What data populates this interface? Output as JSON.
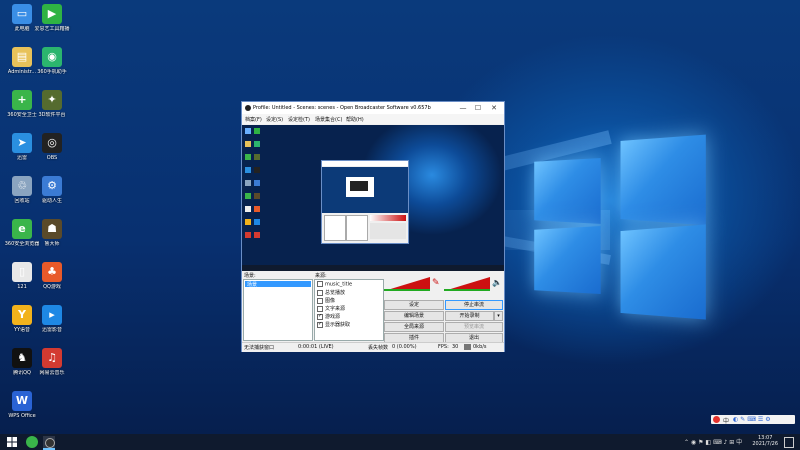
{
  "desktop": {
    "icons": [
      {
        "label": "此电脑",
        "icon": "computer-icon",
        "color": "#3a8ee6",
        "glyph": "▭"
      },
      {
        "label": "爱思艺工具箱播",
        "icon": "media-app-icon",
        "color": "#2fb344",
        "glyph": "▶"
      },
      {
        "label": "Administr...",
        "icon": "user-folder-icon",
        "color": "#e8c25a",
        "glyph": "▤"
      },
      {
        "label": "360手机助手",
        "icon": "phone-assistant-icon",
        "color": "#2bb56e",
        "glyph": "◉"
      },
      {
        "label": "360安全卫士",
        "icon": "security-shield-icon",
        "color": "#3ab54a",
        "glyph": "+"
      },
      {
        "label": "3D软件平台",
        "icon": "3d-app-icon",
        "color": "#556b2f",
        "glyph": "✦"
      },
      {
        "label": "迅雷",
        "icon": "thunder-icon",
        "color": "#2a8fe0",
        "glyph": "➤"
      },
      {
        "label": "OBS",
        "icon": "obs-icon",
        "color": "#222222",
        "glyph": "◎"
      },
      {
        "label": "回收站",
        "icon": "recycle-bin-icon",
        "color": "#8aa4c0",
        "glyph": "♲"
      },
      {
        "label": "驱动人生",
        "icon": "driver-app-icon",
        "color": "#3b7bd4",
        "glyph": "⚙"
      },
      {
        "label": "360安全浏览器",
        "icon": "browser-icon",
        "color": "#3ab54a",
        "glyph": "e"
      },
      {
        "label": "鲁大师",
        "icon": "benchmark-icon",
        "color": "#5a4a2a",
        "glyph": "☗"
      },
      {
        "label": "121",
        "icon": "document-icon",
        "color": "#e8e8e8",
        "glyph": "▯"
      },
      {
        "label": "QQ游戏",
        "icon": "qq-game-icon",
        "color": "#e85a2a",
        "glyph": "♣"
      },
      {
        "label": "YY语音",
        "icon": "yy-icon",
        "color": "#f2b21c",
        "glyph": "Y"
      },
      {
        "label": "迅雷影音",
        "icon": "video-player-icon",
        "color": "#1e88e5",
        "glyph": "▸"
      },
      {
        "label": "腾讯QQ",
        "icon": "qq-icon",
        "color": "#111111",
        "glyph": "♞"
      },
      {
        "label": "网易云音乐",
        "icon": "music-icon",
        "color": "#d33a31",
        "glyph": "♫"
      },
      {
        "label": "WPS Office",
        "icon": "wps-icon",
        "color": "#2a63d4",
        "glyph": "W"
      }
    ]
  },
  "obs": {
    "title": "Profile: Untitled - Scenes: scenes - Open Broadcaster Software v0.657b",
    "menu": [
      "档案(F)",
      "设定(S)",
      "设定检(T)",
      "场景集合(C)",
      "帮助(H)"
    ],
    "scenes_label": "场景:",
    "scenes": [
      "场景"
    ],
    "sources_label": "来源:",
    "sources": [
      {
        "label": "music_title",
        "checked": false
      },
      {
        "label": "总览播放",
        "checked": false
      },
      {
        "label": "图像",
        "checked": false
      },
      {
        "label": "文字来源",
        "checked": false
      },
      {
        "label": "游戏源",
        "checked": true
      },
      {
        "label": "显示器获取",
        "checked": true
      }
    ],
    "buttons": {
      "settings": "设定",
      "stop_stream": "停止串流",
      "edit_scene": "编辑场景",
      "start_record": "开始录制",
      "global_sources": "全局来源",
      "preview": "预览串流",
      "plugins": "插件",
      "exit": "退出"
    },
    "status": {
      "message": "无法捕获窗口",
      "time": "0:00:01 (LIVE)",
      "dropped_label": "丢失帧数",
      "dropped_value": "0 (0.00%)",
      "fps_label": "FPS:",
      "fps_value": "30",
      "bitrate": "0kb/s"
    }
  },
  "taskbar": {
    "time": "13:07",
    "date": "2021/7/26",
    "ime_label": "中"
  },
  "colors": {
    "desktop_blue": "#0a3a7c",
    "accent_light": "#6ec3ff",
    "meter_red": "#cc1111",
    "selection": "#3399ff"
  }
}
